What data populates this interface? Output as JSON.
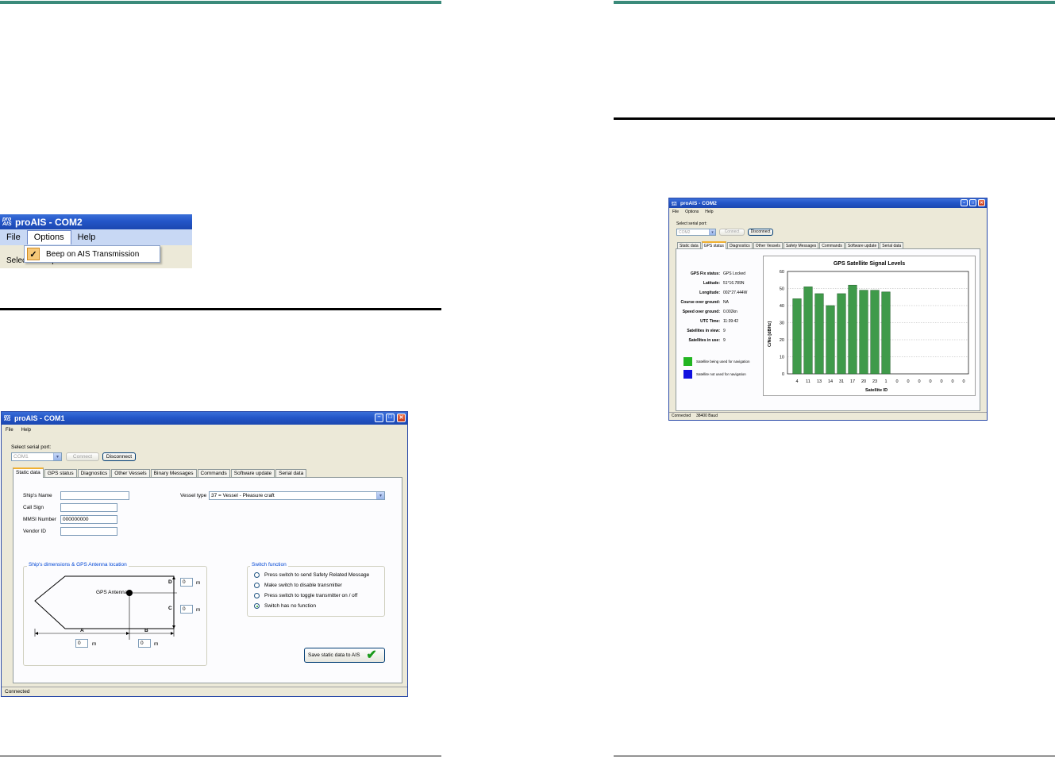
{
  "menu_screenshot": {
    "title": "proAIS - COM2",
    "logo": "pro AIS",
    "menu": [
      "File",
      "Options",
      "Help"
    ],
    "dropdown_item": "Beep on AIS Transmission",
    "below_text": "Select serial port:"
  },
  "static_window": {
    "title": "proAIS - COM1",
    "menu": [
      "File",
      "Help"
    ],
    "select_port_label": "Select serial port:",
    "port_value": "COM1",
    "connect_label": "Connect",
    "disconnect_label": "Disconnect",
    "tabs": [
      "Static data",
      "GPS status",
      "Diagnostics",
      "Other Vessels",
      "Binary Messages",
      "Commands",
      "Software update",
      "Serial data"
    ],
    "fields": {
      "ships_name_label": "Ship's Name",
      "call_sign_label": "Call Sign",
      "mmsi_label": "MMSI Number",
      "mmsi_value": "000000000",
      "vendor_label": "Vendor ID",
      "vessel_type_label": "Vessel type",
      "vessel_type_value": "37 = Vessel - Pleasure craft"
    },
    "dimensions_group": "Ship's dimensions & GPS Antenna location",
    "gps_antenna_label": "GPS Antenna",
    "dim_labels": {
      "a": "A",
      "b": "B",
      "c": "C",
      "d": "D"
    },
    "dim_values": {
      "a": "0",
      "b": "0",
      "c": "0",
      "d": "0"
    },
    "unit": "m",
    "switch_group": "Switch function",
    "switch_options": [
      "Press switch to send Safety Related Message",
      "Make switch to disable transmitter",
      "Press switch to toggle transmitter on / off",
      "Switch has no function"
    ],
    "switch_selected": 3,
    "save_label": "Save static data to AIS",
    "status": "Connected"
  },
  "gps_window": {
    "title": "proAIS - COM2",
    "menu": [
      "File",
      "Options",
      "Help"
    ],
    "select_port_label": "Select serial port:",
    "port_value": "COM2",
    "connect_label": "Connect",
    "disconnect_label": "Disconnect",
    "tabs": [
      "Static data",
      "GPS status",
      "Diagnostics",
      "Other Vessels",
      "Safety Messages",
      "Commands",
      "Software update",
      "Serial data"
    ],
    "info": [
      {
        "k": "GPS Fix status:",
        "v": "GPS Locked"
      },
      {
        "k": "Latitude:",
        "v": "51°16.789N"
      },
      {
        "k": "Longitude:",
        "v": "002°27.444W"
      },
      {
        "k": "Course over ground:",
        "v": "NA"
      },
      {
        "k": "Speed over ground:",
        "v": "0.002kn"
      },
      {
        "k": "UTC Time:",
        "v": "11:39:42"
      },
      {
        "k": "Satellites in view:",
        "v": "9"
      },
      {
        "k": "Satellites in use:",
        "v": "9"
      }
    ],
    "legend": [
      {
        "label": "Satellite being used for navigation",
        "color": "#22b522"
      },
      {
        "label": "Satellite not used for navigation",
        "color": "#1010e0"
      }
    ],
    "status": "Connected",
    "baud": "38400 Baud"
  },
  "chart_data": {
    "type": "bar",
    "title": "GPS Satellite Signal Levels",
    "xlabel": "Satellite ID",
    "ylabel": "C/No [dBHz]",
    "categories": [
      "4",
      "11",
      "13",
      "14",
      "31",
      "17",
      "20",
      "23",
      "1",
      "0",
      "0",
      "0",
      "0",
      "0",
      "0",
      "0"
    ],
    "values": [
      44,
      51,
      47,
      40,
      47,
      52,
      49,
      49,
      48,
      0,
      0,
      0,
      0,
      0,
      0,
      0
    ],
    "ylim": [
      0,
      60
    ],
    "yticks": [
      0,
      10,
      20,
      30,
      40,
      50,
      60
    ],
    "grid": true,
    "bar_color": "#3f9a4a"
  }
}
